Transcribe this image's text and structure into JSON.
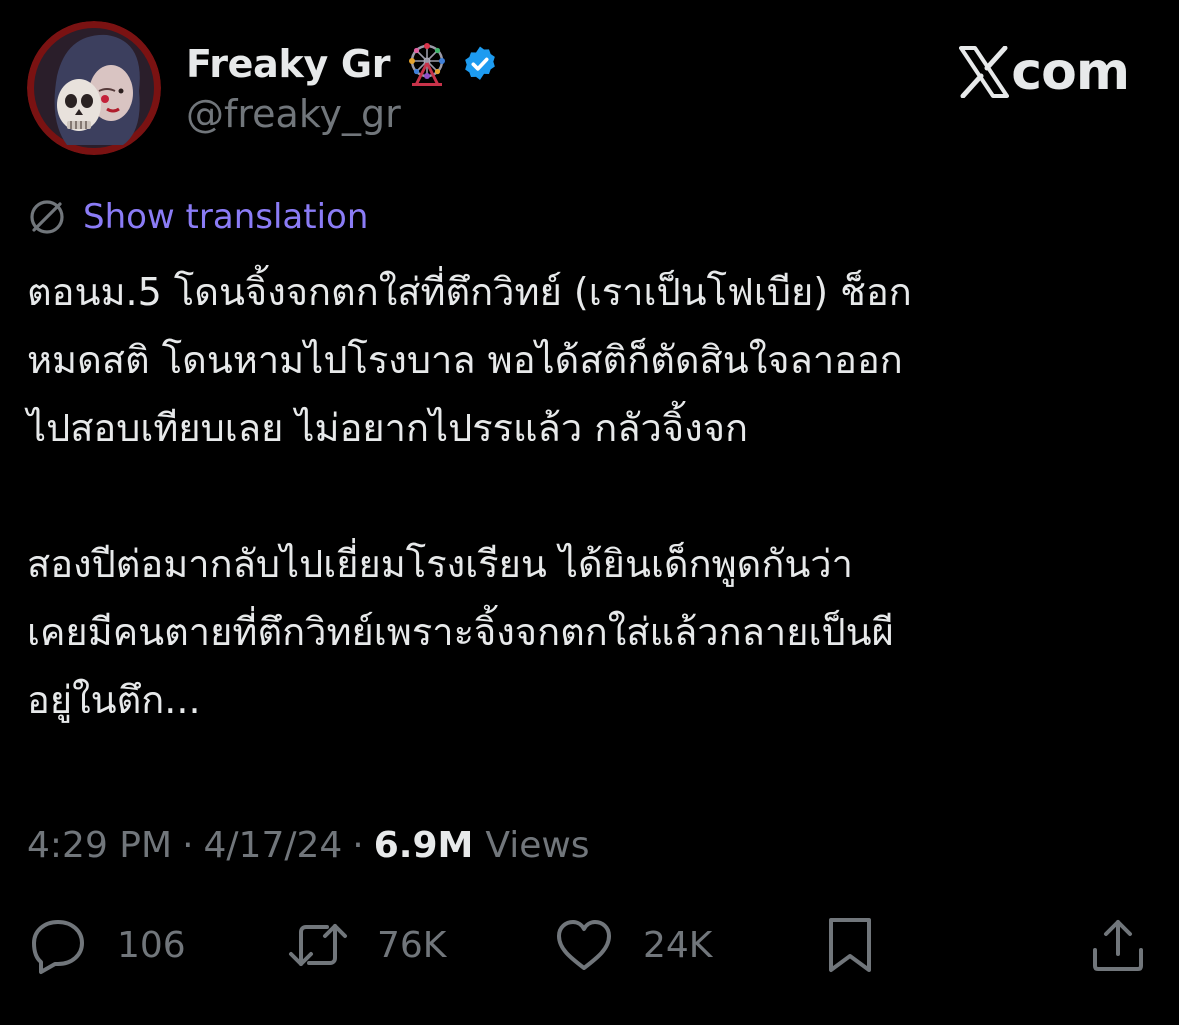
{
  "header": {
    "display_name": "Freaky Gr",
    "handle": "@freaky_gr",
    "name_emoji": "ferris-wheel-icon",
    "verified_badge": "verified-icon",
    "brand": "com",
    "brand_icon": "x-logo-icon"
  },
  "translation": {
    "icon": "globe-icon",
    "label": "Show translation"
  },
  "tweet": {
    "paragraphs": [
      "ตอนม.5 โดนจิ้งจกตกใส่ที่ตึกวิทย์ (เราเป็นโฟเบีย) ช็อก\nหมดสติ โดนหามไปโรงบาล พอได้สติก็ตัดสินใจลาออก\nไปสอบเทียบเลย ไม่อยากไปรรแล้ว กลัวจิ้งจก",
      "สองปีต่อมากลับไปเยี่ยมโรงเรียน ได้ยินเด็กพูดกันว่า\nเคยมีคนตายที่ตึกวิทย์เพราะจิ้งจกตกใส่แล้วกลายเป็นผี\nอยู่ในตึก..."
    ]
  },
  "meta": {
    "time": "4:29 PM",
    "separator": "·",
    "date": "4/17/24",
    "views_count": "6.9M",
    "views_label": "Views"
  },
  "actions": {
    "reply_count": "106",
    "repost_count": "76K",
    "like_count": "24K"
  },
  "colors": {
    "background": "#000000",
    "primary_text": "#e7e9ea",
    "secondary_text": "#71767b",
    "translation_link": "#8b7cf6",
    "verified_blue": "#1d9bf0",
    "avatar_ring": "#7a1212"
  }
}
